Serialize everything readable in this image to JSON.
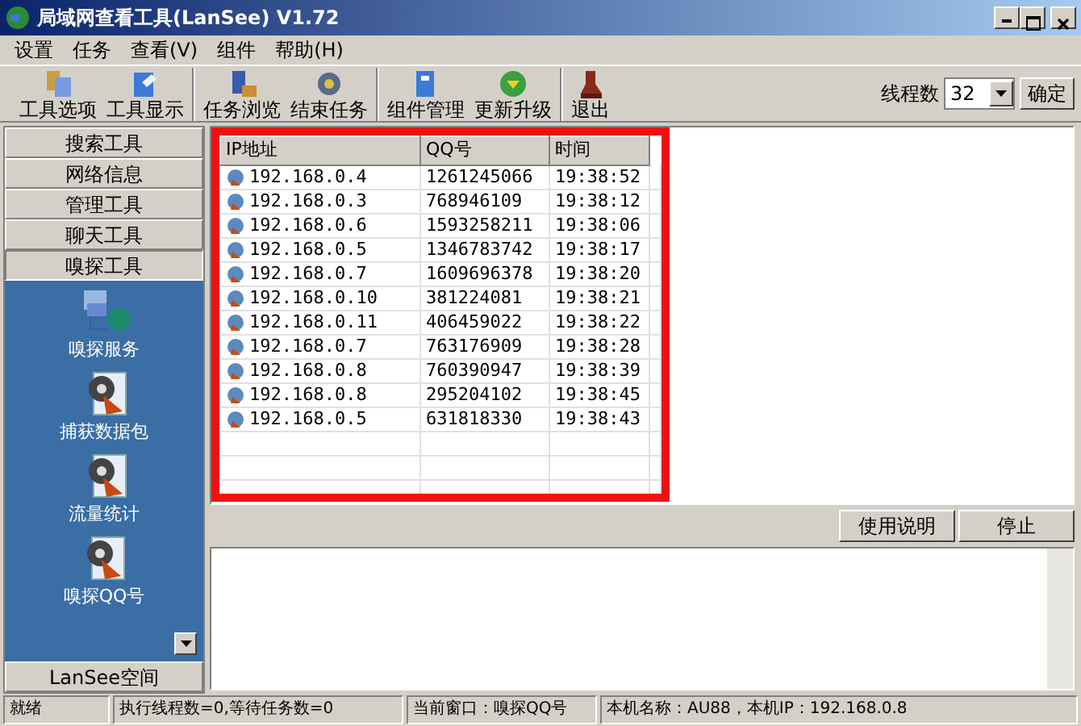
{
  "window": {
    "title": "局域网查看工具(LanSee) V1.72"
  },
  "menu": [
    "设置",
    "任务",
    "查看(V)",
    "组件",
    "帮助(H)"
  ],
  "toolbar": {
    "groups": [
      [
        "工具选项",
        "工具显示"
      ],
      [
        "任务浏览",
        "结束任务"
      ],
      [
        "组件管理",
        "更新升级"
      ],
      [
        "退出"
      ]
    ],
    "thread_label": "线程数",
    "thread_value": "32",
    "confirm": "确定"
  },
  "sidebar": {
    "sections": [
      {
        "label": "搜索工具",
        "selected": false
      },
      {
        "label": "网络信息",
        "selected": false
      },
      {
        "label": "管理工具",
        "selected": false
      },
      {
        "label": "聊天工具",
        "selected": false
      },
      {
        "label": "嗅探工具",
        "selected": true
      }
    ],
    "items": [
      "嗅探服务",
      "捕获数据包",
      "流量统计",
      "嗅探QQ号"
    ],
    "bottom": "LanSee空间"
  },
  "table": {
    "columns": [
      "IP地址",
      "QQ号",
      "时间"
    ],
    "rows": [
      [
        "192.168.0.4",
        "1261245066",
        "19:38:52"
      ],
      [
        "192.168.0.3",
        "768946109",
        "19:38:12"
      ],
      [
        "192.168.0.6",
        "1593258211",
        "19:38:06"
      ],
      [
        "192.168.0.5",
        "1346783742",
        "19:38:17"
      ],
      [
        "192.168.0.7",
        "1609696378",
        "19:38:20"
      ],
      [
        "192.168.0.10",
        "381224081",
        "19:38:21"
      ],
      [
        "192.168.0.11",
        "406459022",
        "19:38:22"
      ],
      [
        "192.168.0.7",
        "763176909",
        "19:38:28"
      ],
      [
        "192.168.0.8",
        "760390947",
        "19:38:39"
      ],
      [
        "192.168.0.8",
        "295204102",
        "19:38:45"
      ],
      [
        "192.168.0.5",
        "631818330",
        "19:38:43"
      ]
    ]
  },
  "actions": [
    "使用说明",
    "停止"
  ],
  "status_bar": [
    "就绪",
    "执行线程数=0,等待任务数=0",
    "当前窗口：嗅探QQ号",
    "本机名称：AU88，本机IP：192.168.0.8"
  ]
}
